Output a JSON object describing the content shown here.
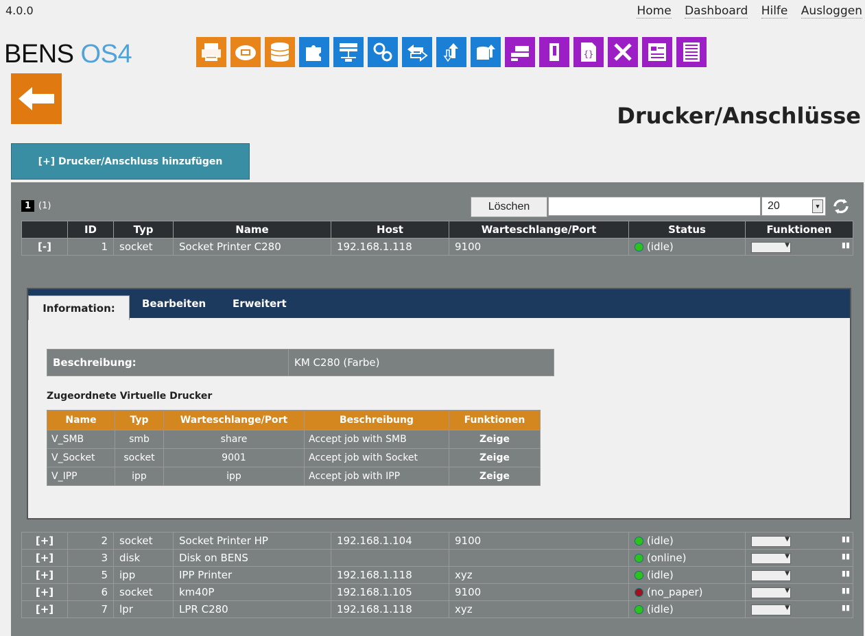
{
  "version": "4.0.0",
  "nav": {
    "home": "Home",
    "dashboard": "Dashboard",
    "help": "Hilfe",
    "logout": "Ausloggen"
  },
  "logo": {
    "main": "BENS",
    "sub": "OS4"
  },
  "toolbar_icons": [
    "printer-icon",
    "cloud-printer-icon",
    "database-icon",
    "puzzle-icon",
    "network-icon",
    "gears-icon",
    "transfer-icon",
    "upload-icon",
    "db-upload-icon",
    "scanner-icon",
    "book-icon",
    "code-icon",
    "tools-icon",
    "form-icon",
    "list-icon"
  ],
  "page_title": "Drucker/Anschlüsse",
  "add_button": "[+] Drucker/Anschluss hinzufügen",
  "pager": {
    "current": "1",
    "total": "(1)"
  },
  "delete_button": "Löschen",
  "filter_value": "",
  "page_size": "20",
  "columns": [
    "",
    "ID",
    "Typ",
    "Name",
    "Host",
    "Warteschlange/Port",
    "Status",
    "Funktionen"
  ],
  "expanded_row": {
    "toggle": "[-]",
    "id": "1",
    "type": "socket",
    "name": "Socket Printer C280",
    "host": "192.168.1.118",
    "port": "9100",
    "status": "(idle)",
    "status_color": "green"
  },
  "detail": {
    "tabs": [
      "Information:",
      "Bearbeiten",
      "Erweitert"
    ],
    "desc_label": "Beschreibung:",
    "desc_value": "KM C280 (Farbe)",
    "virtual_heading": "Zugeordnete Virtuelle Drucker",
    "vcols": [
      "Name",
      "Typ",
      "Warteschlange/Port",
      "Beschreibung",
      "Funktionen"
    ],
    "virtual": [
      {
        "name": "V_SMB",
        "type": "smb",
        "port": "share",
        "desc": "Accept job with SMB",
        "fn": "Zeige"
      },
      {
        "name": "V_Socket",
        "type": "socket",
        "port": "9001",
        "desc": "Accept job with Socket",
        "fn": "Zeige"
      },
      {
        "name": "V_IPP",
        "type": "ipp",
        "port": "ipp",
        "desc": "Accept job with IPP",
        "fn": "Zeige"
      }
    ]
  },
  "rows": [
    {
      "toggle": "[+]",
      "id": "2",
      "type": "socket",
      "name": "Socket Printer HP",
      "host": "192.168.1.104",
      "port": "9100",
      "status": "(idle)",
      "status_color": "green"
    },
    {
      "toggle": "[+]",
      "id": "3",
      "type": "disk",
      "name": "Disk on BENS",
      "host": "",
      "port": "",
      "status": "(online)",
      "status_color": "green"
    },
    {
      "toggle": "[+]",
      "id": "5",
      "type": "ipp",
      "name": "IPP Printer",
      "host": "192.168.1.118",
      "port": "xyz",
      "status": "(idle)",
      "status_color": "green"
    },
    {
      "toggle": "[+]",
      "id": "6",
      "type": "socket",
      "name": "km40P",
      "host": "192.168.1.105",
      "port": "9100",
      "status": "(no_paper)",
      "status_color": "red"
    },
    {
      "toggle": "[+]",
      "id": "7",
      "type": "lpr",
      "name": "LPR C280",
      "host": "192.168.1.118",
      "port": "xyz",
      "status": "(idle)",
      "status_color": "green"
    }
  ],
  "colors": {
    "orange": "#e8851a",
    "blue": "#1c7fd6",
    "purple": "#9b1fc4",
    "header": "#2b2f31",
    "vd_header": "#d4861f"
  }
}
